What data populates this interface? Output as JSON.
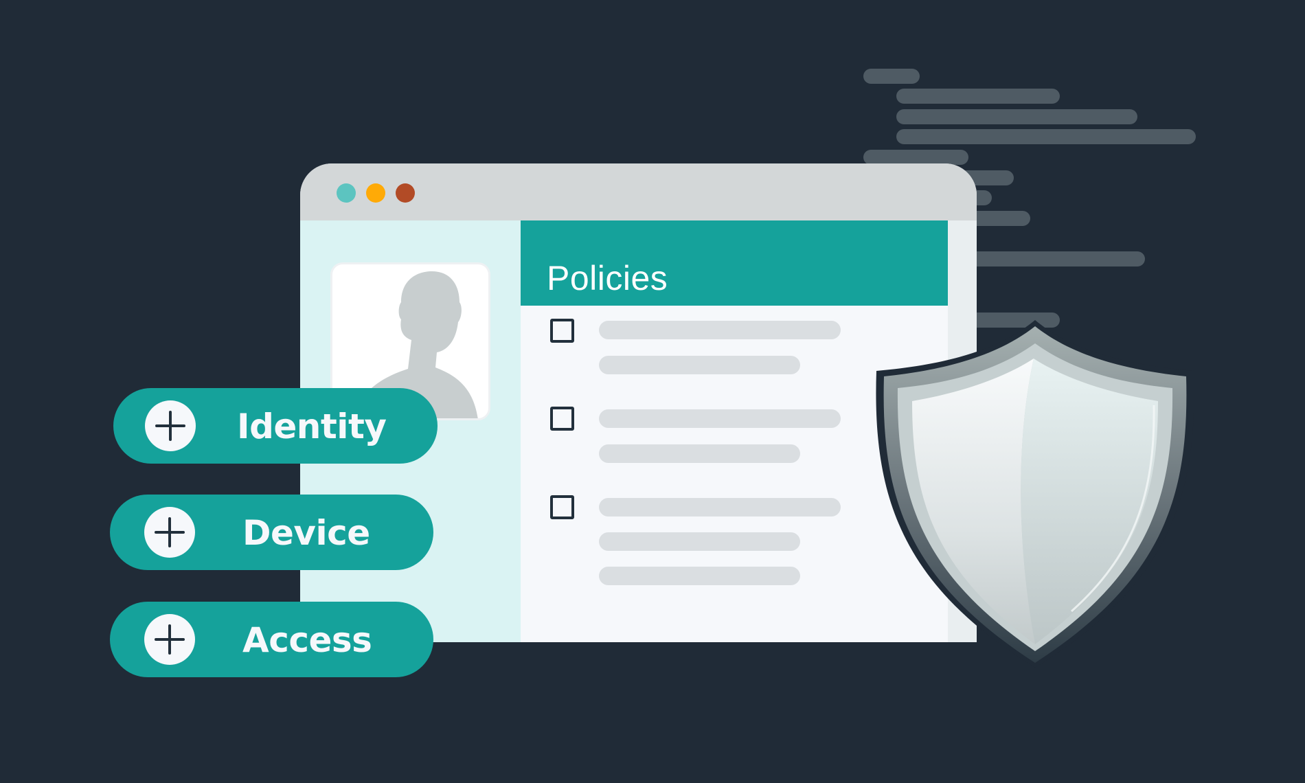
{
  "colors": {
    "background": "#202b37",
    "accent_teal": "#15a29b",
    "code_bar": "#4f5b64",
    "dot_teal": "#5cc4c0",
    "dot_amber": "#ffaa07",
    "dot_rust": "#b24b26"
  },
  "window": {
    "controls": [
      {
        "name": "minimize",
        "color": "#5cc4c0"
      },
      {
        "name": "maximize",
        "color": "#ffaa07"
      },
      {
        "name": "close",
        "color": "#b24b26"
      }
    ],
    "header": {
      "title": "Policies"
    },
    "policies": [
      {
        "checked": false,
        "lines": 2
      },
      {
        "checked": false,
        "lines": 2
      },
      {
        "checked": false,
        "lines": 3
      }
    ]
  },
  "pills": [
    {
      "label": "Identity",
      "icon": "plus-icon"
    },
    {
      "label": "Device",
      "icon": "plus-icon"
    },
    {
      "label": "Access",
      "icon": "plus-icon"
    }
  ],
  "decor": {
    "avatar": "user-silhouette-icon",
    "shield": "shield-icon",
    "code_lines": 10
  }
}
